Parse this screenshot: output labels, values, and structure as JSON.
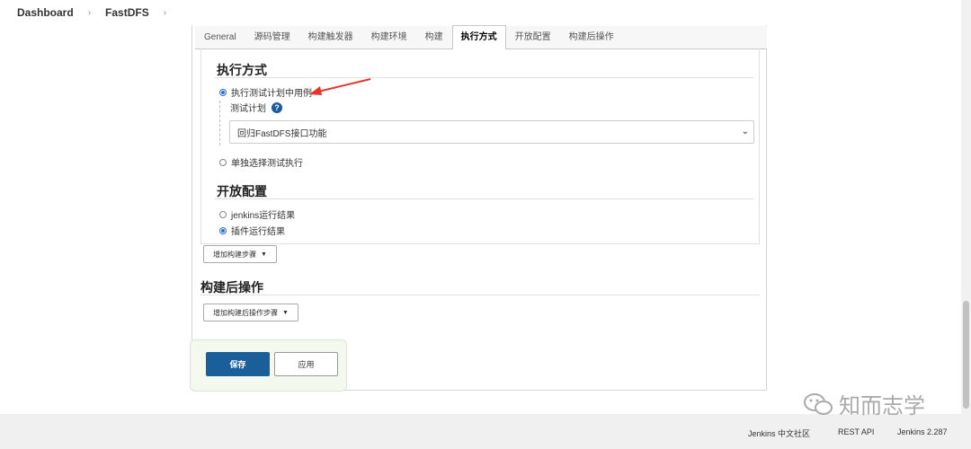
{
  "breadcrumb": {
    "items": [
      "Dashboard",
      "FastDFS"
    ],
    "separator": "›"
  },
  "tabs": [
    "General",
    "源码管理",
    "构建触发器",
    "构建环境",
    "构建",
    "执行方式",
    "开放配置",
    "构建后操作"
  ],
  "active_tab": "执行方式",
  "exec_section": {
    "title": "执行方式",
    "option1": "执行测试计划中用例",
    "test_plan_label": "测试计划",
    "help_icon": "question-mark",
    "select_value": "回归FastDFS接口功能",
    "option2": "单独选择测试执行"
  },
  "open_config": {
    "title": "开放配置",
    "option1": "jenkins运行结果",
    "option2": "插件运行结果"
  },
  "add_build_step": "增加构建步骤",
  "post_build": {
    "title": "构建后操作",
    "add_button": "增加构建后操作步骤"
  },
  "save_label": "保存",
  "apply_label": "应用",
  "watermark": "知而志学",
  "footer": {
    "community": "Jenkins 中文社区",
    "rest_api": "REST API",
    "version": "Jenkins 2.287"
  },
  "colors": {
    "primary": "#1a5e9a",
    "arrow": "#e5352d",
    "save_area": "#f3f9ee"
  }
}
